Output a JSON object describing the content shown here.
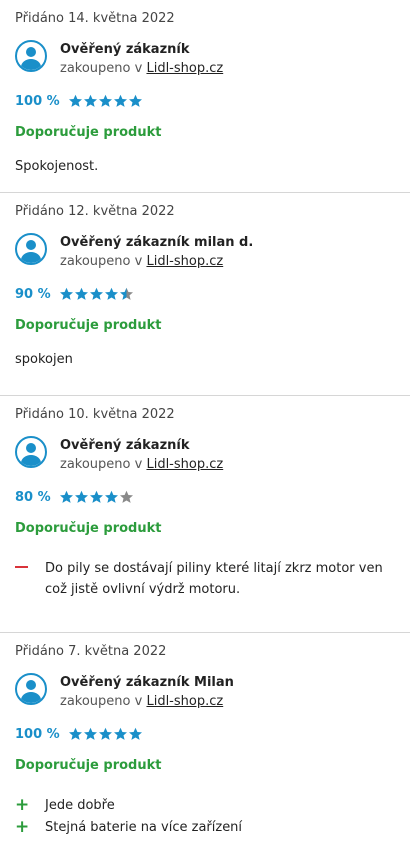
{
  "reviews": [
    {
      "date": "Přidáno 14. května 2022",
      "name": "Ověřený zákazník",
      "bought_prefix": "zakoupeno v",
      "shop": "Lidl-shop.cz",
      "percent": "100 %",
      "stars": 5,
      "recommend": "Doporučuje produkt",
      "comment": "Spokojenost."
    },
    {
      "date": "Přidáno 12. května 2022",
      "name": "Ověřený zákazník milan d.",
      "bought_prefix": "zakoupeno v",
      "shop": "Lidl-shop.cz",
      "percent": "90 %",
      "stars": 4.5,
      "recommend": "Doporučuje produkt",
      "comment": "spokojen"
    },
    {
      "date": "Přidáno 10. května 2022",
      "name": "Ověřený zákazník",
      "bought_prefix": "zakoupeno v",
      "shop": "Lidl-shop.cz",
      "percent": "80 %",
      "stars": 4,
      "recommend": "Doporučuje produkt",
      "cons": [
        "Do pily se dostávají piliny které litají zkrz motor ven což jistě ovlivní výdrž motoru."
      ]
    },
    {
      "date": "Přidáno 7. května 2022",
      "name": "Ověřený zákazník Milan",
      "bought_prefix": "zakoupeno v",
      "shop": "Lidl-shop.cz",
      "percent": "100 %",
      "stars": 5,
      "recommend": "Doporučuje produkt",
      "pros": [
        "Jede dobře",
        "Stejná baterie na více zařízení"
      ]
    }
  ],
  "colors": {
    "accent": "#1a8fc9",
    "recommend": "#2c9c3c",
    "con": "#d9333a",
    "star_empty": "#8a8a8a"
  }
}
